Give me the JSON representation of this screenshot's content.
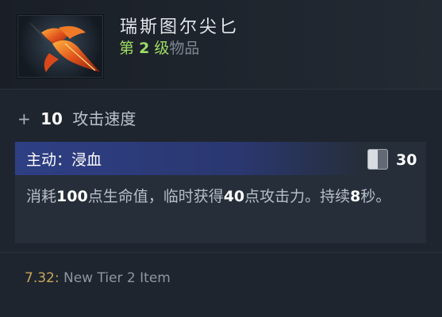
{
  "item": {
    "name": "瑞斯图尔尖匕",
    "tier_prefix": "第",
    "tier_number": "2",
    "tier_suffix": "级",
    "tier_word": "物品",
    "icon": "dagger-icon"
  },
  "stats": [
    {
      "sign": "+",
      "value": "10",
      "label": "攻击速度"
    }
  ],
  "ability": {
    "title": "主动：浸血",
    "cooldown_icon": "cooldown-icon",
    "cooldown": "30",
    "desc_part1": "消耗",
    "desc_val1": "100",
    "desc_part2": "点生命值，临时获得",
    "desc_val2": "40",
    "desc_part3": "点攻击力。持续",
    "desc_val3": "8",
    "desc_part4": "秒。"
  },
  "patch": {
    "version": "7.32:",
    "note": "New Tier 2 Item"
  },
  "colors": {
    "tier": "#9ddb62",
    "ability_header": "#2e3f84",
    "patch_version": "#c7a75a",
    "background": "#1f252e"
  }
}
